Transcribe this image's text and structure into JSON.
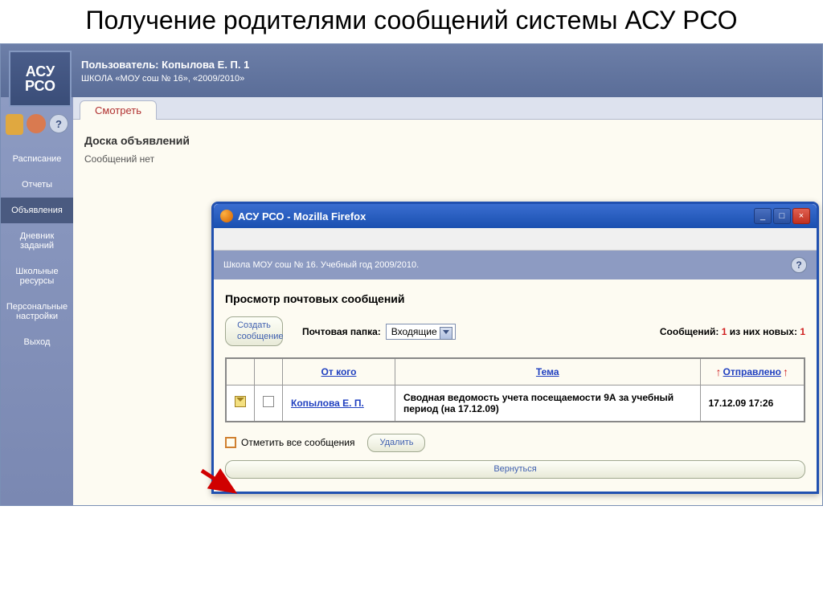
{
  "slide_title": "Получение родителями сообщений системы АСУ РСО",
  "logo": {
    "line1": "АСУ",
    "line2": "РСО"
  },
  "header": {
    "user_label": "Пользователь: Копылова Е. П. 1",
    "school_label": "ШКОЛА «МОУ сош № 16», «2009/2010»"
  },
  "nav_items": [
    {
      "label": "Расписание"
    },
    {
      "label": "Отчеты"
    },
    {
      "label": "Объявления"
    },
    {
      "label": "Дневник заданий"
    },
    {
      "label": "Школьные ресурсы"
    },
    {
      "label": "Персональные настройки"
    },
    {
      "label": "Выход"
    }
  ],
  "tab_label": "Смотреть",
  "board": {
    "title": "Доска объявлений",
    "empty": "Сообщений нет"
  },
  "popup": {
    "title": "АСУ РСО - Mozilla Firefox",
    "info_strip": "Школа МОУ сош № 16. Учебный год 2009/2010.",
    "mail_title": "Просмотр почтовых сообщений",
    "create_btn": "Создать сообщение",
    "folder_label": "Почтовая папка:",
    "folder_value": "Входящие",
    "count_prefix": "Сообщений: ",
    "count_total": "1",
    "count_mid": " из них новых: ",
    "count_new": "1",
    "columns": {
      "from": "От кого",
      "subject": "Тема",
      "sent": "Отправлено"
    },
    "rows": [
      {
        "from": "Копылова Е. П.",
        "subject": "Сводная ведомость учета посещаемости 9А за учебный период (на 17.12.09)",
        "date": "17.12.09 17:26"
      }
    ],
    "mark_all": "Отметить все сообщения",
    "delete_btn": "Удалить",
    "back_btn": "Вернуться"
  }
}
